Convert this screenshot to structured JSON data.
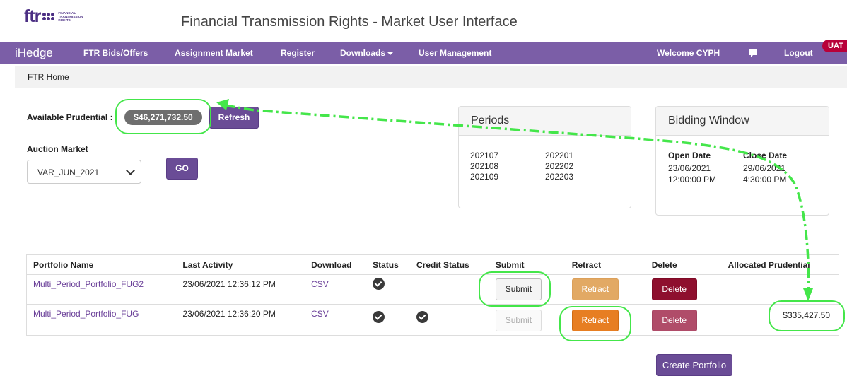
{
  "header": {
    "logo_text": "ftr",
    "logo_subtext": "FINANCIAL TRANSMISSION RIGHTS",
    "app_title": "Financial Transmission Rights - Market User Interface"
  },
  "navbar": {
    "brand": "iHedge",
    "items": [
      {
        "label": "FTR Bids/Offers"
      },
      {
        "label": "Assignment Market"
      },
      {
        "label": "Register"
      },
      {
        "label": "Downloads"
      },
      {
        "label": "User Management"
      }
    ],
    "welcome": "Welcome CYPH",
    "chat_icon": "comment-icon",
    "logout": "Logout",
    "env_badge": "UAT"
  },
  "breadcrumb": "FTR Home",
  "prudential": {
    "label": "Available Prudential :",
    "value": "$46,271,732.50",
    "refresh_label": "Refresh"
  },
  "auction": {
    "label": "Auction Market",
    "selected": "VAR_JUN_2021",
    "go_label": "GO"
  },
  "periods": {
    "title": "Periods",
    "col1": [
      "202107",
      "202108",
      "202109"
    ],
    "col2": [
      "202201",
      "202202",
      "202203"
    ]
  },
  "bidding": {
    "title": "Bidding Window",
    "open_label": "Open Date",
    "close_label": "Close Date",
    "open_date": "23/06/2021",
    "open_time": "12:00:00 PM",
    "close_date": "29/06/2021",
    "close_time": "4:30:00 PM"
  },
  "table": {
    "headers": [
      "Portfolio Name",
      "Last Activity",
      "Download",
      "Status",
      "Credit Status",
      "Submit",
      "Retract",
      "Delete",
      "Allocated Prudential"
    ],
    "rows": [
      {
        "name": "Multi_Period_Portfolio_FUG2",
        "last_activity": "23/06/2021 12:36:12 PM",
        "download": "CSV",
        "status_icon": "check-circle-icon",
        "credit_icon": "",
        "submit": "Submit",
        "retract": "Retract",
        "delete": "Delete",
        "allocated": ""
      },
      {
        "name": "Multi_Period_Portfolio_FUG",
        "last_activity": "23/06/2021 12:36:20 PM",
        "download": "CSV",
        "status_icon": "check-circle-icon",
        "credit_icon": "check-circle-icon",
        "submit": "Submit",
        "retract": "Retract",
        "delete": "Delete",
        "allocated": "$335,427.50"
      }
    ]
  },
  "create_portfolio": "Create Portfolio",
  "colors": {
    "navbar": "#7b5ea7",
    "brand_purple": "#6a4c96",
    "retract": "#e77e22",
    "delete": "#8e0f2e",
    "annotation": "#44e64a"
  }
}
